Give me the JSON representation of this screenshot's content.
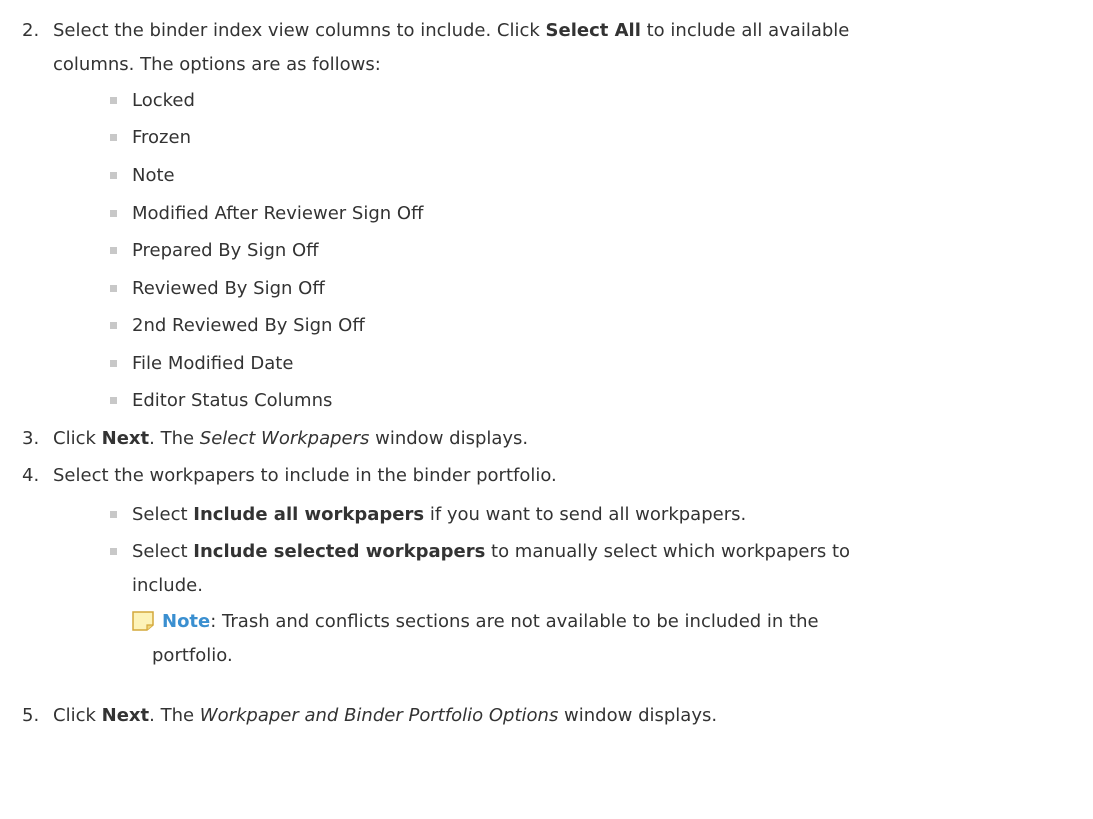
{
  "step2": {
    "number": "2.",
    "line1_pre": "Select the binder index view columns to include. Click ",
    "line1_bold": "Select All",
    "line1_post": " to include all available",
    "line2": "columns. The options are as follows:",
    "options": [
      "Locked",
      "Frozen",
      "Note",
      "Modified After Reviewer Sign Off",
      "Prepared By Sign Off",
      "Reviewed By Sign Off",
      "2nd Reviewed By Sign Off",
      "File Modified Date",
      "Editor Status Columns"
    ]
  },
  "step3": {
    "number": "3.",
    "pre": "Click ",
    "bold": "Next",
    "mid": ". The ",
    "italic": "Select Workpapers",
    "post": " window displays."
  },
  "step4": {
    "number": "4.",
    "text": "Select the workpapers to include in the binder portfolio.",
    "sub1_pre": "Select ",
    "sub1_bold": "Include all workpapers",
    "sub1_post": " if you want to send all workpapers.",
    "sub2_pre": "Select ",
    "sub2_bold": "Include selected workpapers",
    "sub2_post": " to manually select which workpapers to",
    "sub2_line2": "include.",
    "note_label": "Note",
    "note_text": ": Trash and conflicts sections are not available to be included in the",
    "note_line2": "portfolio."
  },
  "step5": {
    "number": "5.",
    "pre": "Click ",
    "bold": "Next",
    "mid": ". The ",
    "italic": "Workpaper and Binder Portfolio Options",
    "post": " window displays."
  }
}
